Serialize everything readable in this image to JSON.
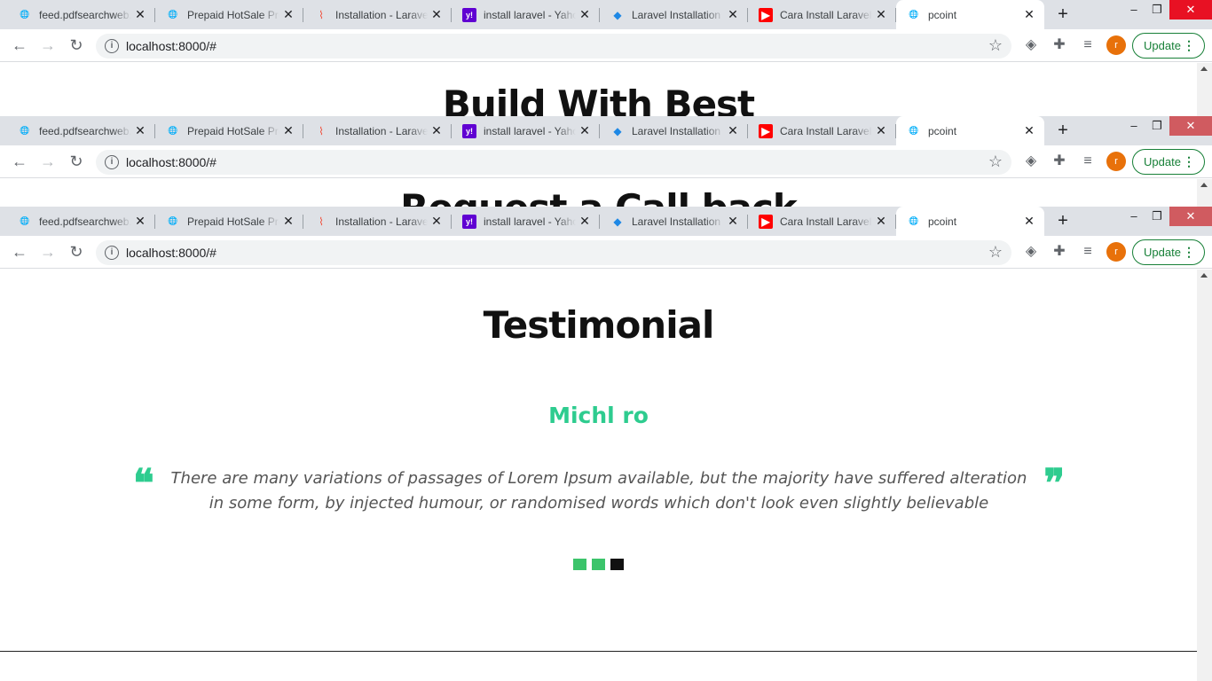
{
  "tabs": [
    {
      "title": "feed.pdfsearchweb.",
      "icon": "globe-icon"
    },
    {
      "title": "Prepaid HotSale Pro",
      "icon": "globe-icon"
    },
    {
      "title": "Installation - Larave",
      "icon": "laravel-icon"
    },
    {
      "title": "install laravel - Yaho",
      "icon": "yahoo-icon"
    },
    {
      "title": "Laravel Installation",
      "icon": "laravel-blue-icon"
    },
    {
      "title": "Cara Install Laravel",
      "icon": "youtube-icon"
    },
    {
      "title": "pcoint",
      "icon": "globe-icon",
      "active": true
    }
  ],
  "toolbar": {
    "url": "localhost:8000/#",
    "profile_initial": "r",
    "update_label": "Update"
  },
  "window1": {
    "heading": "Build With Best"
  },
  "window2": {
    "heading": "Request a Call back"
  },
  "testimonial": {
    "title": "Testimonial",
    "name": "Michl ro",
    "quote": "There are many variations of passages of Lorem Ipsum available, but the majority have suffered alteration in some form, by injected humour, or randomised words which don't look even slightly believable",
    "open_mark": "❝",
    "close_mark": "❞",
    "slide_count": 3,
    "active_slide": 3
  },
  "colors": {
    "accent": "#2ecc8f",
    "dot": "#3cc46b",
    "dot_active": "#111111",
    "update": "#188038",
    "avatar": "#e8710a"
  }
}
